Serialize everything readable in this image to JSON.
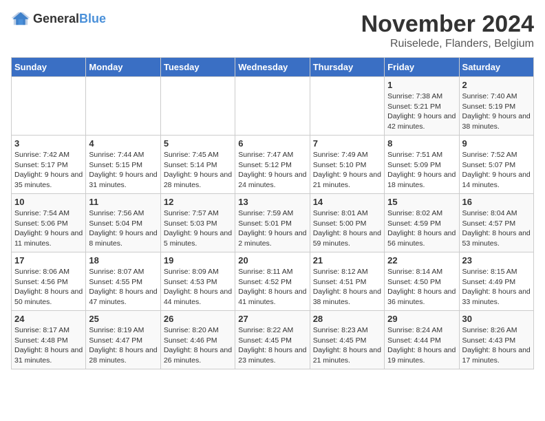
{
  "logo": {
    "general": "General",
    "blue": "Blue"
  },
  "title": "November 2024",
  "subtitle": "Ruiselede, Flanders, Belgium",
  "days_of_week": [
    "Sunday",
    "Monday",
    "Tuesday",
    "Wednesday",
    "Thursday",
    "Friday",
    "Saturday"
  ],
  "weeks": [
    [
      {
        "day": "",
        "info": ""
      },
      {
        "day": "",
        "info": ""
      },
      {
        "day": "",
        "info": ""
      },
      {
        "day": "",
        "info": ""
      },
      {
        "day": "",
        "info": ""
      },
      {
        "day": "1",
        "info": "Sunrise: 7:38 AM\nSunset: 5:21 PM\nDaylight: 9 hours and 42 minutes."
      },
      {
        "day": "2",
        "info": "Sunrise: 7:40 AM\nSunset: 5:19 PM\nDaylight: 9 hours and 38 minutes."
      }
    ],
    [
      {
        "day": "3",
        "info": "Sunrise: 7:42 AM\nSunset: 5:17 PM\nDaylight: 9 hours and 35 minutes."
      },
      {
        "day": "4",
        "info": "Sunrise: 7:44 AM\nSunset: 5:15 PM\nDaylight: 9 hours and 31 minutes."
      },
      {
        "day": "5",
        "info": "Sunrise: 7:45 AM\nSunset: 5:14 PM\nDaylight: 9 hours and 28 minutes."
      },
      {
        "day": "6",
        "info": "Sunrise: 7:47 AM\nSunset: 5:12 PM\nDaylight: 9 hours and 24 minutes."
      },
      {
        "day": "7",
        "info": "Sunrise: 7:49 AM\nSunset: 5:10 PM\nDaylight: 9 hours and 21 minutes."
      },
      {
        "day": "8",
        "info": "Sunrise: 7:51 AM\nSunset: 5:09 PM\nDaylight: 9 hours and 18 minutes."
      },
      {
        "day": "9",
        "info": "Sunrise: 7:52 AM\nSunset: 5:07 PM\nDaylight: 9 hours and 14 minutes."
      }
    ],
    [
      {
        "day": "10",
        "info": "Sunrise: 7:54 AM\nSunset: 5:06 PM\nDaylight: 9 hours and 11 minutes."
      },
      {
        "day": "11",
        "info": "Sunrise: 7:56 AM\nSunset: 5:04 PM\nDaylight: 9 hours and 8 minutes."
      },
      {
        "day": "12",
        "info": "Sunrise: 7:57 AM\nSunset: 5:03 PM\nDaylight: 9 hours and 5 minutes."
      },
      {
        "day": "13",
        "info": "Sunrise: 7:59 AM\nSunset: 5:01 PM\nDaylight: 9 hours and 2 minutes."
      },
      {
        "day": "14",
        "info": "Sunrise: 8:01 AM\nSunset: 5:00 PM\nDaylight: 8 hours and 59 minutes."
      },
      {
        "day": "15",
        "info": "Sunrise: 8:02 AM\nSunset: 4:59 PM\nDaylight: 8 hours and 56 minutes."
      },
      {
        "day": "16",
        "info": "Sunrise: 8:04 AM\nSunset: 4:57 PM\nDaylight: 8 hours and 53 minutes."
      }
    ],
    [
      {
        "day": "17",
        "info": "Sunrise: 8:06 AM\nSunset: 4:56 PM\nDaylight: 8 hours and 50 minutes."
      },
      {
        "day": "18",
        "info": "Sunrise: 8:07 AM\nSunset: 4:55 PM\nDaylight: 8 hours and 47 minutes."
      },
      {
        "day": "19",
        "info": "Sunrise: 8:09 AM\nSunset: 4:53 PM\nDaylight: 8 hours and 44 minutes."
      },
      {
        "day": "20",
        "info": "Sunrise: 8:11 AM\nSunset: 4:52 PM\nDaylight: 8 hours and 41 minutes."
      },
      {
        "day": "21",
        "info": "Sunrise: 8:12 AM\nSunset: 4:51 PM\nDaylight: 8 hours and 38 minutes."
      },
      {
        "day": "22",
        "info": "Sunrise: 8:14 AM\nSunset: 4:50 PM\nDaylight: 8 hours and 36 minutes."
      },
      {
        "day": "23",
        "info": "Sunrise: 8:15 AM\nSunset: 4:49 PM\nDaylight: 8 hours and 33 minutes."
      }
    ],
    [
      {
        "day": "24",
        "info": "Sunrise: 8:17 AM\nSunset: 4:48 PM\nDaylight: 8 hours and 31 minutes."
      },
      {
        "day": "25",
        "info": "Sunrise: 8:19 AM\nSunset: 4:47 PM\nDaylight: 8 hours and 28 minutes."
      },
      {
        "day": "26",
        "info": "Sunrise: 8:20 AM\nSunset: 4:46 PM\nDaylight: 8 hours and 26 minutes."
      },
      {
        "day": "27",
        "info": "Sunrise: 8:22 AM\nSunset: 4:45 PM\nDaylight: 8 hours and 23 minutes."
      },
      {
        "day": "28",
        "info": "Sunrise: 8:23 AM\nSunset: 4:45 PM\nDaylight: 8 hours and 21 minutes."
      },
      {
        "day": "29",
        "info": "Sunrise: 8:24 AM\nSunset: 4:44 PM\nDaylight: 8 hours and 19 minutes."
      },
      {
        "day": "30",
        "info": "Sunrise: 8:26 AM\nSunset: 4:43 PM\nDaylight: 8 hours and 17 minutes."
      }
    ]
  ]
}
